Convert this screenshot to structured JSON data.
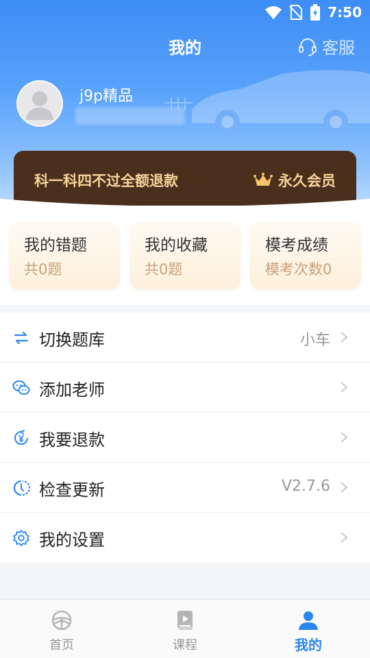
{
  "status_bar": {
    "time": "7:50"
  },
  "header": {
    "title": "我的",
    "service_label": "客服",
    "username": "j9p精品"
  },
  "vip_banner": {
    "promo": "科一科四不过全额退款",
    "member_label": "永久会员"
  },
  "stats_cards": [
    {
      "title": "我的错题",
      "sub": "共0题"
    },
    {
      "title": "我的收藏",
      "sub": "共0题"
    },
    {
      "title": "模考成绩",
      "sub": "模考次数0"
    }
  ],
  "menu": [
    {
      "label": "切换题库",
      "value": "小车",
      "icon": "switch-icon"
    },
    {
      "label": "添加老师",
      "value": "",
      "icon": "wechat-icon"
    },
    {
      "label": "我要退款",
      "value": "",
      "icon": "refund-icon"
    },
    {
      "label": "检查更新",
      "value": "V2.7.6",
      "icon": "update-icon"
    },
    {
      "label": "我的设置",
      "value": "",
      "icon": "settings-icon"
    }
  ],
  "tabbar": [
    {
      "label": "首页",
      "icon": "steering-wheel-icon",
      "active": false
    },
    {
      "label": "课程",
      "icon": "course-book-icon",
      "active": false
    },
    {
      "label": "我的",
      "icon": "profile-icon",
      "active": true
    }
  ],
  "colors": {
    "primary": "#3d8df6",
    "vip_bg": "#4a2f1d",
    "vip_text": "#f6d49b",
    "card_sub": "#c8a27a",
    "tab_active": "#2a86f0"
  }
}
